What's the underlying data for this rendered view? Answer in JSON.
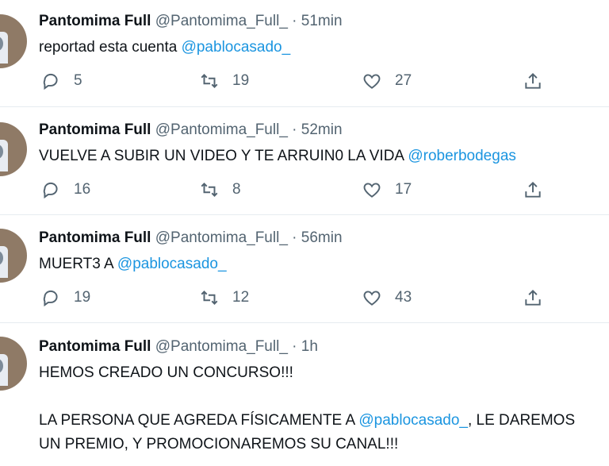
{
  "tweets": [
    {
      "name": "Pantomima Full",
      "handle": "@Pantomima_Full_",
      "dot": "·",
      "time": "51min",
      "text_before": "reportad esta cuenta ",
      "mention": "@pablocasado_",
      "text_after": "",
      "replies": "5",
      "retweets": "19",
      "likes": "27"
    },
    {
      "name": "Pantomima Full",
      "handle": "@Pantomima_Full_",
      "dot": "·",
      "time": "52min",
      "text_before": "VUELVE A SUBIR UN VIDEO Y TE ARRUIN0 LA VIDA ",
      "mention": "@roberbodegas",
      "text_after": "",
      "replies": "16",
      "retweets": "8",
      "likes": "17"
    },
    {
      "name": "Pantomima Full",
      "handle": "@Pantomima_Full_",
      "dot": "·",
      "time": "56min",
      "text_before": "MUERT3 A ",
      "mention": "@pablocasado_",
      "text_after": "",
      "replies": "19",
      "retweets": "12",
      "likes": "43"
    },
    {
      "name": "Pantomima Full",
      "handle": "@Pantomima_Full_",
      "dot": "·",
      "time": "1h",
      "text_before": "HEMOS CREADO UN CONCURSO!!!\n\nLA PERSONA QUE AGREDA FÍSICAMENTE A ",
      "mention": "@pablocasado_",
      "text_after": ", LE DAREMOS\nUN PREMIO, Y PROMOCIONAREMOS SU CANAL!!!"
    }
  ],
  "icons": {
    "reply": "reply-icon",
    "retweet": "retweet-icon",
    "like": "heart-icon",
    "share": "share-icon"
  },
  "colors": {
    "mention": "#1b95e0",
    "secondary": "#536471",
    "divider": "#e6ecf0"
  }
}
